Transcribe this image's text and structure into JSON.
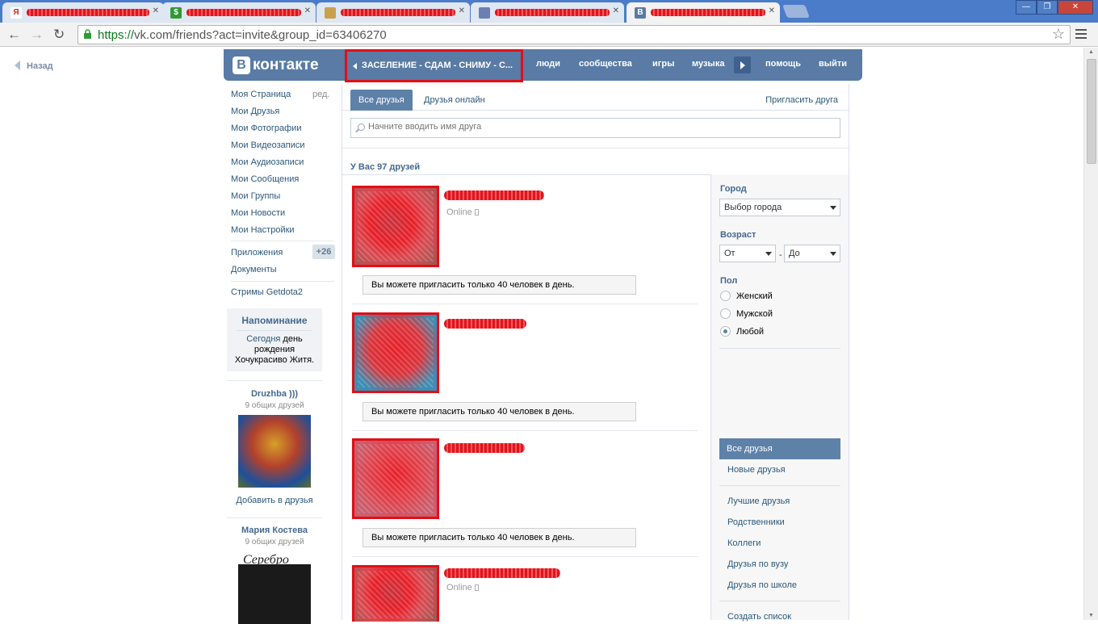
{
  "browser": {
    "tabs": [
      {
        "favicon": "Я",
        "favicon_color": "#e11e1e",
        "title": "декс"
      },
      {
        "favicon": "$",
        "favicon_color": "#2f9a36",
        "title": ""
      },
      {
        "favicon": "",
        "favicon_color": "#c8a14a",
        "title": ""
      },
      {
        "favicon": "",
        "favicon_color": "#6a7fb3",
        "title": ""
      },
      {
        "favicon": "В",
        "favicon_color": "#597ba5",
        "title": ""
      }
    ],
    "window_buttons": [
      "—",
      "❐",
      "✕"
    ],
    "url_protocol": "https://",
    "url_rest": "vk.com/friends?act=invite&group_id=63406270"
  },
  "page": {
    "back_label": "Назад",
    "logo_letter": "В",
    "logo_text": "контакте",
    "group_title": "ЗАСЕЛЕНИЕ - СДАМ - СНИМУ - С...",
    "topnav": [
      "люди",
      "сообщества",
      "игры",
      "музыка",
      "помощь",
      "выйти"
    ],
    "sidebar": {
      "edit_label": "ред.",
      "items": [
        "Моя Страница",
        "Мои Друзья",
        "Мои Фотографии",
        "Мои Видеозаписи",
        "Мои Аудиозаписи",
        "Мои Сообщения",
        "Мои Группы",
        "Мои Новости",
        "Мои Настройки"
      ],
      "apps_label": "Приложения",
      "apps_badge": "+26",
      "docs_label": "Документы",
      "streams_label": "Стримы Getdota2"
    },
    "reminder": {
      "title": "Напоминание",
      "link": "Сегодня",
      "text1": " день рождения",
      "text2": "Хочукрасиво Житя."
    },
    "suggestions": [
      {
        "name": "Druzhba )))",
        "common": "9 общих друзей",
        "add": "Добавить в друзья"
      },
      {
        "name": "Мария Костева",
        "common": "9 общих друзей",
        "add": ""
      }
    ],
    "tabs": {
      "all": "Все друзья",
      "online": "Друзья онлайн",
      "invite": "Пригласить друга"
    },
    "search_placeholder": "Начните вводить имя друга",
    "count_label": "У Вас 97 друзей",
    "friends": [
      {
        "status": "Online",
        "note": "Вы можете пригласить только 40 человек в день."
      },
      {
        "status": "",
        "note": "Вы можете пригласить только 40 человек в день."
      },
      {
        "status": "",
        "note": "Вы можете пригласить только 40 человек в день."
      },
      {
        "status": "Online",
        "note": ""
      }
    ],
    "filters": {
      "city_label": "Город",
      "city_value": "Выбор города",
      "age_label": "Возраст",
      "age_from": "От",
      "age_dash": "-",
      "age_to": "До",
      "gender_label": "Пол",
      "genders": [
        "Женский",
        "Мужской",
        "Любой"
      ],
      "gender_selected": 2,
      "lists": [
        "Все друзья",
        "Новые друзья",
        "Лучшие друзья",
        "Родственники",
        "Коллеги",
        "Друзья по вузу",
        "Друзья по школе",
        "Создать список"
      ]
    }
  },
  "colors": {
    "vk_header": "#597ba5",
    "link": "#2b587a",
    "accent_red": "#e20e17"
  }
}
